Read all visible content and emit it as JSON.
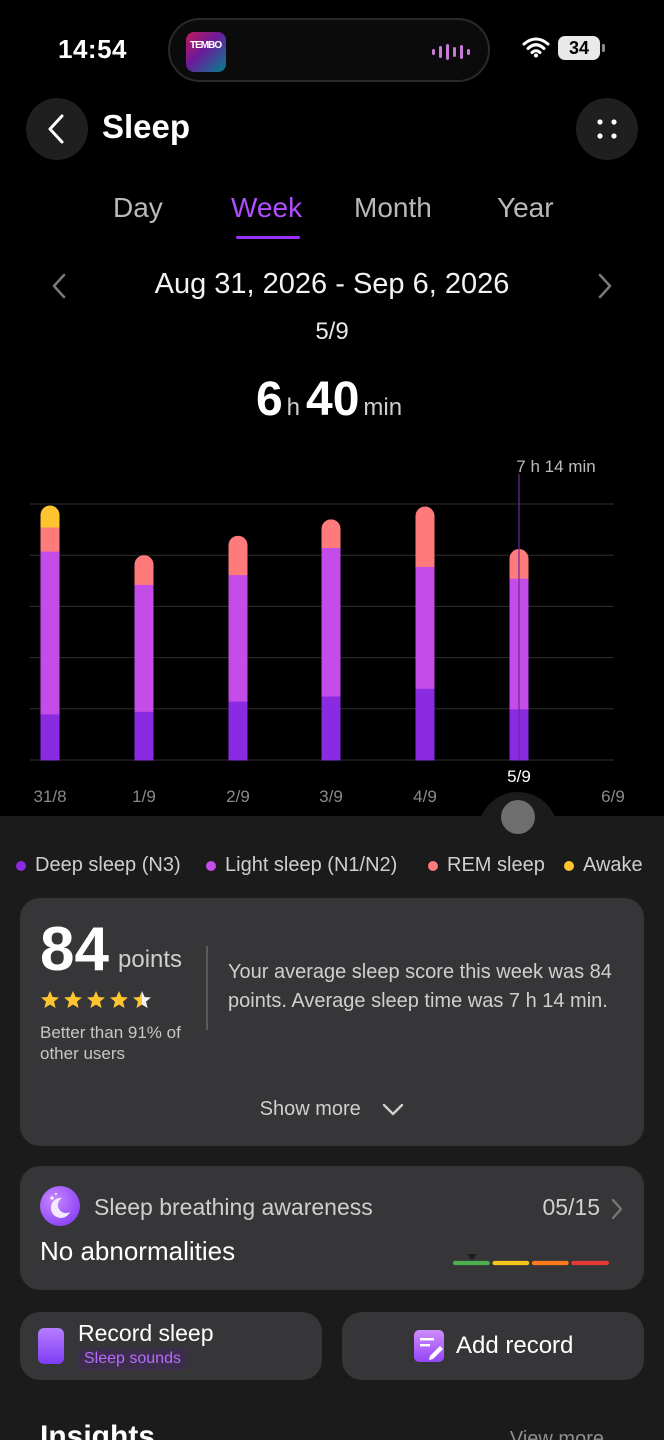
{
  "status_bar": {
    "time": "14:54",
    "battery": "34"
  },
  "header": {
    "title": "Sleep"
  },
  "tabs": [
    {
      "label": "Day"
    },
    {
      "label": "Week"
    },
    {
      "label": "Month"
    },
    {
      "label": "Year"
    }
  ],
  "active_tab": "Week",
  "range": {
    "label": "Aug 31, 2026 - Sep 6, 2026"
  },
  "selection": {
    "date": "5/9",
    "hours": "6",
    "hours_unit": "h",
    "minutes": "40",
    "minutes_unit": "min"
  },
  "chart_data": {
    "type": "bar",
    "stacked": true,
    "categories": [
      "31/8",
      "1/9",
      "2/9",
      "3/9",
      "4/9",
      "5/9",
      "6/9"
    ],
    "selected_category": "5/9",
    "reference_label": "7 h 14 min",
    "reference_value_min": 434,
    "ylim": [
      0,
      500
    ],
    "grid": true,
    "series": [
      {
        "name": "Deep sleep (N3)",
        "color": "#8a2be2",
        "values": [
          90,
          95,
          115,
          125,
          140,
          100,
          0
        ]
      },
      {
        "name": "Light sleep (N1/N2)",
        "color": "#c44ce8",
        "values": [
          318,
          248,
          247,
          290,
          238,
          255,
          0
        ]
      },
      {
        "name": "REM sleep",
        "color": "#ff7b7b",
        "values": [
          47,
          57,
          76,
          55,
          117,
          57,
          0
        ]
      },
      {
        "name": "Awake",
        "color": "#ffc531",
        "values": [
          42,
          0,
          0,
          0,
          0,
          0,
          0
        ]
      }
    ]
  },
  "legend": [
    {
      "label": "Deep sleep (N3)",
      "color": "#8a2be2"
    },
    {
      "label": "Light sleep (N1/N2)",
      "color": "#c44ce8"
    },
    {
      "label": "REM sleep",
      "color": "#ff7b7b"
    },
    {
      "label": "Awake",
      "color": "#ffc531"
    }
  ],
  "score": {
    "value": "84",
    "unit": "points",
    "stars": 4.5,
    "better_than": "Better than 91% of other users",
    "summary": "Your average sleep score this week was 84 points. Average sleep time was 7 h 14 min.",
    "show_more": "Show more"
  },
  "breathing": {
    "title": "Sleep breathing awareness",
    "date": "05/15",
    "status": "No abnormalities",
    "scale_colors": [
      "#4caf50",
      "#f5c518",
      "#ff7a1a",
      "#e53935"
    ]
  },
  "actions": {
    "record_title": "Record sleep",
    "record_sub": "Sleep sounds",
    "add_title": "Add record"
  },
  "insights": {
    "title": "Insights",
    "view_more": "View more"
  }
}
